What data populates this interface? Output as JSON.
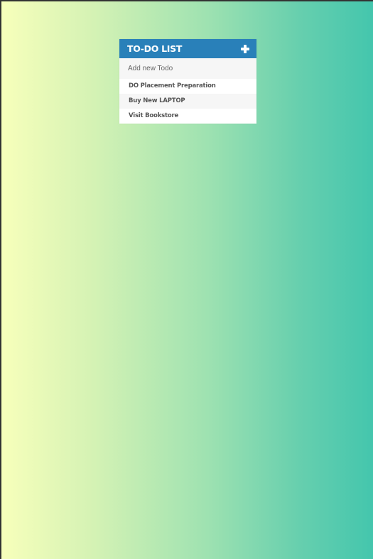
{
  "todo": {
    "title": "TO-DO LIST",
    "add_icon": "plus-icon",
    "input": {
      "placeholder": "Add new Todo",
      "value": ""
    },
    "items": [
      {
        "label": "DO Placement Preparation"
      },
      {
        "label": "Buy New LAPTOP"
      },
      {
        "label": "Visit Bookstore"
      }
    ]
  },
  "colors": {
    "header": "#2980b9",
    "gradient_start": "#f7ffbb",
    "gradient_end": "#44c6ad"
  }
}
